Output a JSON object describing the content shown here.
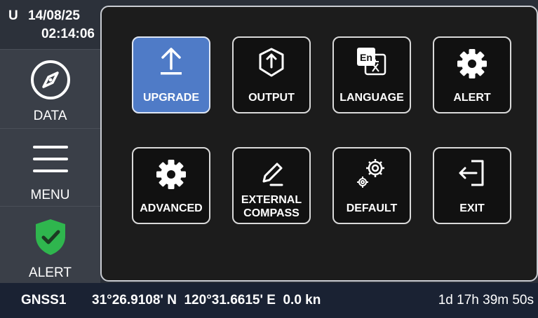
{
  "header": {
    "mode": "U",
    "date": "14/08/25",
    "time": "02:14:06"
  },
  "sidebar": {
    "items": [
      {
        "label": "DATA",
        "icon": "compass-icon"
      },
      {
        "label": "MENU",
        "icon": "hamburger-icon"
      },
      {
        "label": "ALERT",
        "icon": "shield-check-icon"
      }
    ]
  },
  "menu": {
    "tiles": [
      {
        "label": "UPGRADE",
        "icon": "upload-arrow-icon",
        "selected": true
      },
      {
        "label": "OUTPUT",
        "icon": "output-hexagon-icon"
      },
      {
        "label": "LANGUAGE",
        "icon": "language-translate-icon",
        "icon_text": "En"
      },
      {
        "label": "ALERT",
        "icon": "gear-icon"
      },
      {
        "label": "ADVANCED",
        "icon": "gear-icon"
      },
      {
        "label_line1": "EXTERNAL",
        "label_line2": "COMPASS",
        "icon": "pencil-icon"
      },
      {
        "label": "DEFAULT",
        "icon": "gears-icon"
      },
      {
        "label": "EXIT",
        "icon": "exit-door-icon"
      }
    ]
  },
  "status": {
    "source": "GNSS1",
    "position": "31°26.9108' N  120°31.6615' E  0.0 kn",
    "uptime": "1d 17h 39m 50s"
  },
  "colors": {
    "selected_tile": "#4f7bc7",
    "alert_shield": "#2fb64e",
    "status_bar": "#1a2233"
  }
}
